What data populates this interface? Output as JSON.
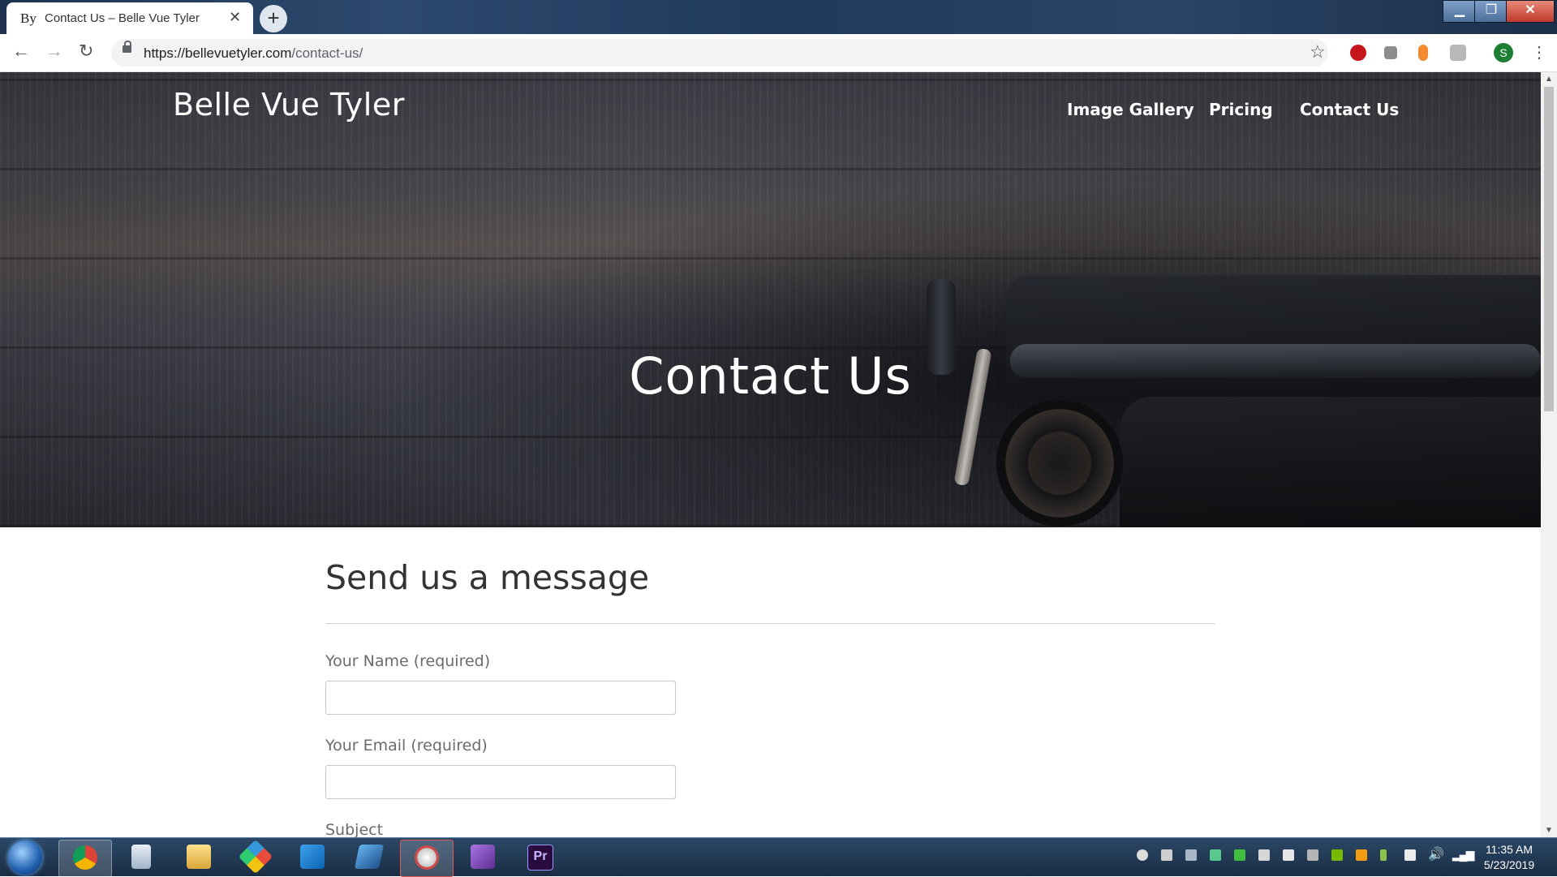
{
  "browser": {
    "tab_title": "Contact Us – Belle Vue Tyler",
    "tab_favicon": "By",
    "url_host": "https://bellevuetyler.com",
    "url_path": "/contact-us/",
    "profile_initial": "S"
  },
  "site": {
    "title": "Belle Vue Tyler",
    "menu": [
      "Image Gallery",
      "Pricing",
      "Contact Us"
    ]
  },
  "hero": {
    "title": "Contact Us"
  },
  "form": {
    "heading": "Send us a message",
    "name_label": "Your Name (required)",
    "email_label": "Your Email (required)",
    "subject_label": "Subject"
  },
  "taskbar": {
    "time": "11:35 AM",
    "date": "5/23/2019",
    "apps": [
      "chrome-icon",
      "calculator-icon",
      "file-explorer-icon",
      "git-icon",
      "vscode-icon",
      "powershell-icon",
      "snipping-tool-icon",
      "visual-studio-icon",
      "premiere-pro-icon"
    ],
    "premiere_label": "Pr"
  },
  "colors": {
    "accent_titlebar": "#1d3350",
    "text_dark": "#333333",
    "label_gray": "#6b6b6b",
    "profile_green": "#1e7e34"
  }
}
